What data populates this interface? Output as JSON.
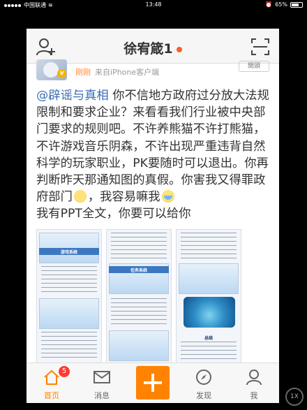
{
  "status_bar": {
    "carrier": "中国联通",
    "time": "13:48",
    "battery": "65%"
  },
  "nav": {
    "title": "徐宥箴1"
  },
  "post": {
    "time": "刚刚",
    "source": "来自iPhone客户端",
    "follow_label": "関頭",
    "mention": "@辟谣与真相",
    "text_part1": " 你不信地方政府过分放大法规限制和要求企业？来看看我们行业被中央部门要求的规则吧。不许养熊猫不许打熊猫，不许游戏音乐阴森，不许出现严重违背自然科学的玩家职业，PK要随时可以退出。你再判断昨天那通知图的真假。你害我又得罪政府部门",
    "text_part2": "，我容易嘛我",
    "text_part3": "我有PPT全文，你要可以给你"
  },
  "thumbs": [
    {
      "label": "游戏系统"
    },
    {
      "label": "任务系统"
    },
    {
      "label": "总结"
    }
  ],
  "tabbar": {
    "home": "首页",
    "home_badge": "5",
    "messages": "消息",
    "discover": "发现",
    "me": "我"
  },
  "zoom": "1X",
  "colors": {
    "accent": "#ff8200",
    "mention": "#3b6fb5",
    "badge": "#ff3b30"
  }
}
